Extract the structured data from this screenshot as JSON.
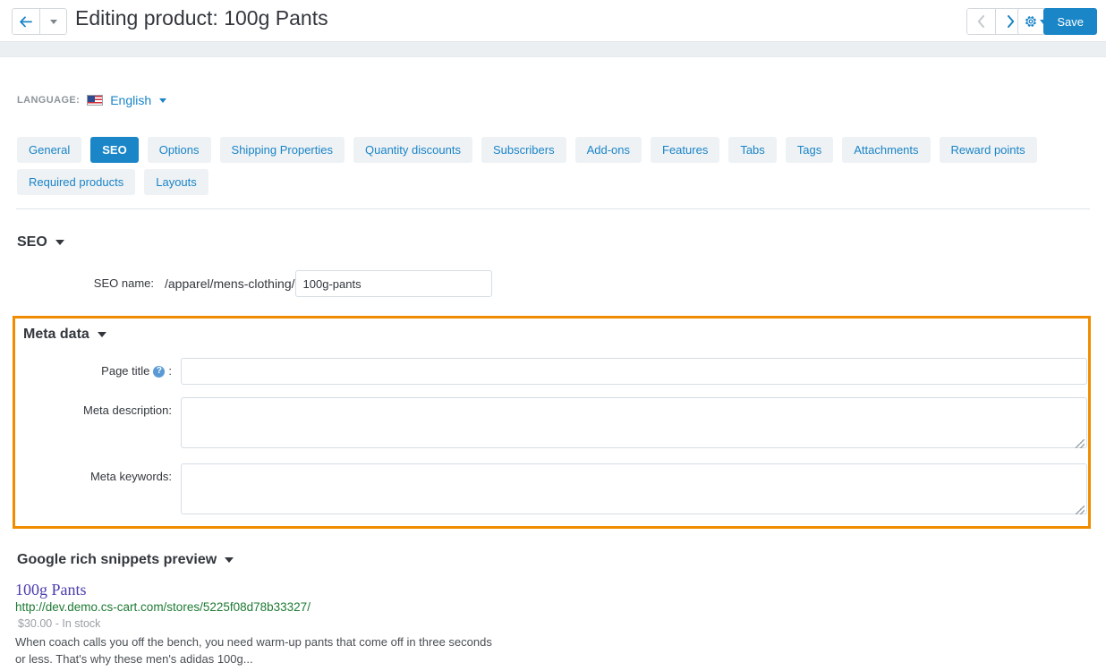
{
  "header": {
    "title": "Editing product: 100g Pants",
    "back_icon": "arrow-left-icon",
    "back_dropdown_icon": "caret-down-icon",
    "prev_icon": "chevron-left-icon",
    "next_icon": "chevron-right-icon",
    "gear_icon": "gear-icon",
    "gear_caret_icon": "caret-down-icon",
    "save_label": "Save"
  },
  "language": {
    "label": "LANGUAGE:",
    "flag_icon": "us-flag-icon",
    "value": "English",
    "caret_icon": "caret-down-icon"
  },
  "tabs": [
    {
      "label": "General",
      "active": false
    },
    {
      "label": "SEO",
      "active": true
    },
    {
      "label": "Options",
      "active": false
    },
    {
      "label": "Shipping Properties",
      "active": false
    },
    {
      "label": "Quantity discounts",
      "active": false
    },
    {
      "label": "Subscribers",
      "active": false
    },
    {
      "label": "Add-ons",
      "active": false
    },
    {
      "label": "Features",
      "active": false
    },
    {
      "label": "Tabs",
      "active": false
    },
    {
      "label": "Tags",
      "active": false
    },
    {
      "label": "Attachments",
      "active": false
    },
    {
      "label": "Reward points",
      "active": false
    },
    {
      "label": "Required products",
      "active": false
    },
    {
      "label": "Layouts",
      "active": false
    }
  ],
  "seo_section": {
    "title": "SEO",
    "collapse_icon": "caret-down-icon",
    "seo_name_label": "SEO name:",
    "seo_name_prefix": "/apparel/mens-clothing/",
    "seo_name_value": "100g-pants",
    "seo_name_placeholder": ""
  },
  "meta_section": {
    "title": "Meta data",
    "collapse_icon": "caret-down-icon",
    "highlight_color": "#f08c00",
    "page_title_label": "Page title",
    "page_title_suffix": ":",
    "page_title_help_icon": "question-mark-icon",
    "page_title_value": "",
    "page_title_placeholder": "",
    "meta_description_label": "Meta description:",
    "meta_description_value": "",
    "meta_description_placeholder": "",
    "meta_keywords_label": "Meta keywords:",
    "meta_keywords_value": "",
    "meta_keywords_placeholder": ""
  },
  "snippet_section": {
    "title": "Google rich snippets preview",
    "collapse_icon": "caret-down-icon",
    "result_title": "100g Pants",
    "result_url": "http://dev.demo.cs-cart.com/stores/5225f08d78b33327/",
    "result_price": "$30.00 - In stock",
    "result_description_line1": "When coach calls you off the bench, you need warm-up pants that come off in three seconds",
    "result_description_line2": "or less. That's why these men's adidas 100g..."
  },
  "colors": {
    "accent_blue": "#1a86c8",
    "link_blue": "#1a84c7",
    "tab_bg": "#eef2f5",
    "highlight_orange": "#f08c00",
    "snippet_title": "#4b3ead",
    "snippet_url": "#1d7a33"
  }
}
